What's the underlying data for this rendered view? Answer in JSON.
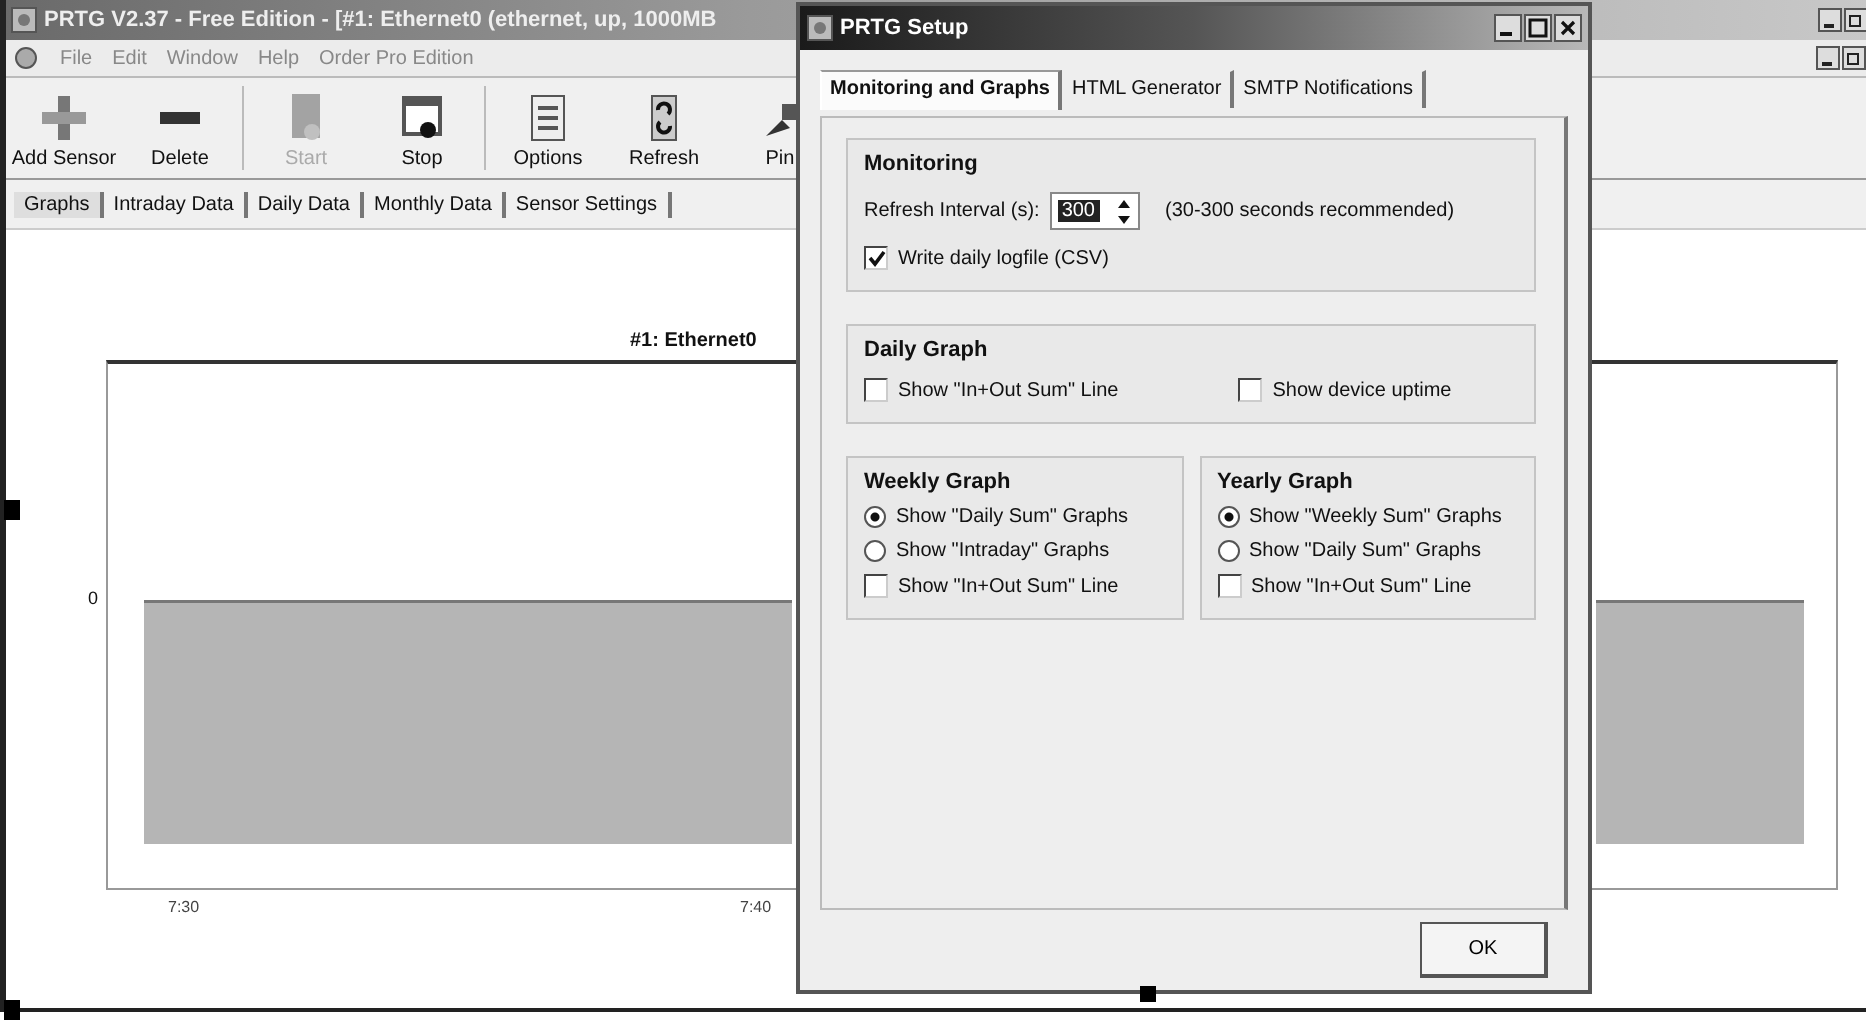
{
  "main_window": {
    "title": "PRTG V2.37 - Free Edition - [#1: Ethernet0 (ethernet, up, 1000MB",
    "menu": [
      "File",
      "Edit",
      "Window",
      "Help",
      "Order Pro Edition"
    ],
    "toolbar": [
      {
        "label": "Add Sensor",
        "disabled": false
      },
      {
        "label": "Delete",
        "disabled": false
      },
      {
        "label": "Start",
        "disabled": true
      },
      {
        "label": "Stop",
        "disabled": false
      },
      {
        "label": "Options",
        "disabled": false
      },
      {
        "label": "Refresh",
        "disabled": false
      },
      {
        "label": "Pin",
        "disabled": false
      }
    ],
    "tabs": [
      {
        "label": "Graphs",
        "selected": true
      },
      {
        "label": "Intraday Data",
        "selected": false
      },
      {
        "label": "Daily Data",
        "selected": false
      },
      {
        "label": "Monthly Data",
        "selected": false
      },
      {
        "label": "Sensor Settings",
        "selected": false
      }
    ],
    "graph": {
      "title": "#1: Ethernet0",
      "y_ticks": [
        "0"
      ],
      "x_ticks": [
        "7:30",
        "7:40"
      ]
    }
  },
  "dialog": {
    "title": "PRTG Setup",
    "tabs": [
      {
        "label": "Monitoring and Graphs",
        "selected": true
      },
      {
        "label": "HTML Generator",
        "selected": false
      },
      {
        "label": "SMTP Notifications",
        "selected": false
      }
    ],
    "monitoring": {
      "title": "Monitoring",
      "interval_label": "Refresh Interval (s):",
      "interval_value": "300",
      "hint": "(30-300 seconds recommended)",
      "logfile": {
        "label": "Write daily logfile (CSV)",
        "checked": true
      }
    },
    "daily_graph": {
      "title": "Daily Graph",
      "options": [
        {
          "label": "Show \"In+Out Sum\" Line",
          "checked": false
        },
        {
          "label": "Show device uptime",
          "checked": false
        }
      ]
    },
    "weekly_graph": {
      "title": "Weekly Graph",
      "radios": [
        {
          "label": "Show \"Daily Sum\" Graphs",
          "selected": true
        },
        {
          "label": "Show \"Intraday\" Graphs",
          "selected": false
        }
      ],
      "checkbox": {
        "label": "Show \"In+Out Sum\" Line",
        "checked": false
      }
    },
    "yearly_graph": {
      "title": "Yearly Graph",
      "radios": [
        {
          "label": "Show \"Weekly Sum\" Graphs",
          "selected": true
        },
        {
          "label": "Show \"Daily Sum\" Graphs",
          "selected": false
        }
      ],
      "checkbox": {
        "label": "Show \"In+Out Sum\" Line",
        "checked": false
      }
    },
    "ok_label": "OK"
  }
}
